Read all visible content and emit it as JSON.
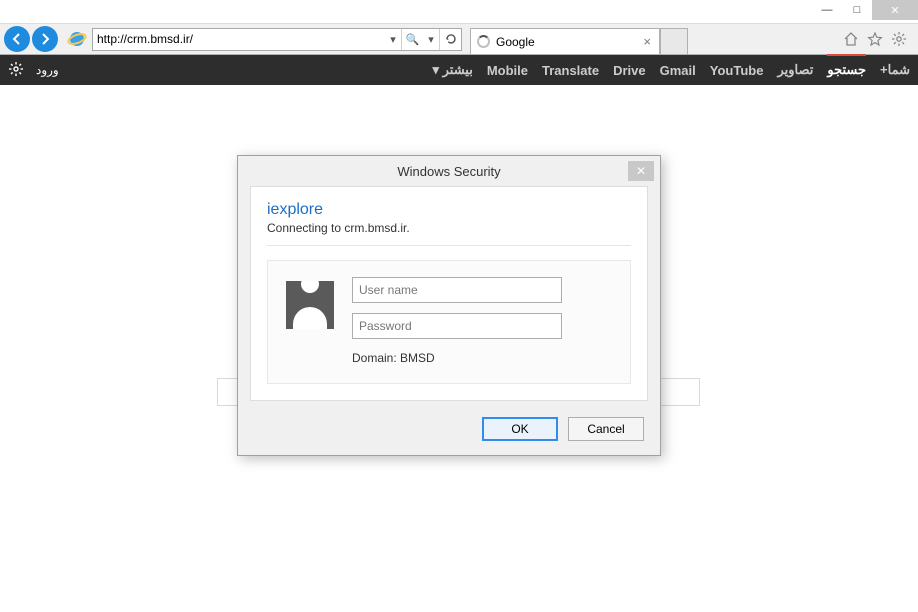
{
  "window": {
    "minimize_glyph": "—",
    "maximize_glyph": "□",
    "close_glyph": "✕"
  },
  "browser": {
    "url": "http://crm.bmsd.ir/",
    "search_glyph": "🔍",
    "dropdown_glyph": "▾",
    "refresh_glyph": "↻",
    "tab": {
      "title": "Google",
      "close_glyph": "×"
    },
    "icons": {
      "home": "⌂",
      "star": "☆",
      "gear": "⚙"
    }
  },
  "gbar": {
    "login": "ورود",
    "more": "بیشتر",
    "caret": "▾",
    "links": [
      "Mobile",
      "Translate",
      "Drive",
      "Gmail",
      "YouTube"
    ],
    "rtl": [
      "تصاویر",
      "جستجو",
      "+شما"
    ],
    "active_index": 1
  },
  "dialog": {
    "title": "Windows Security",
    "close_glyph": "✕",
    "app": "iexplore",
    "message": "Connecting to crm.bmsd.ir.",
    "username_placeholder": "User name",
    "password_placeholder": "Password",
    "domain_label": "Domain: BMSD",
    "ok": "OK",
    "cancel": "Cancel"
  }
}
